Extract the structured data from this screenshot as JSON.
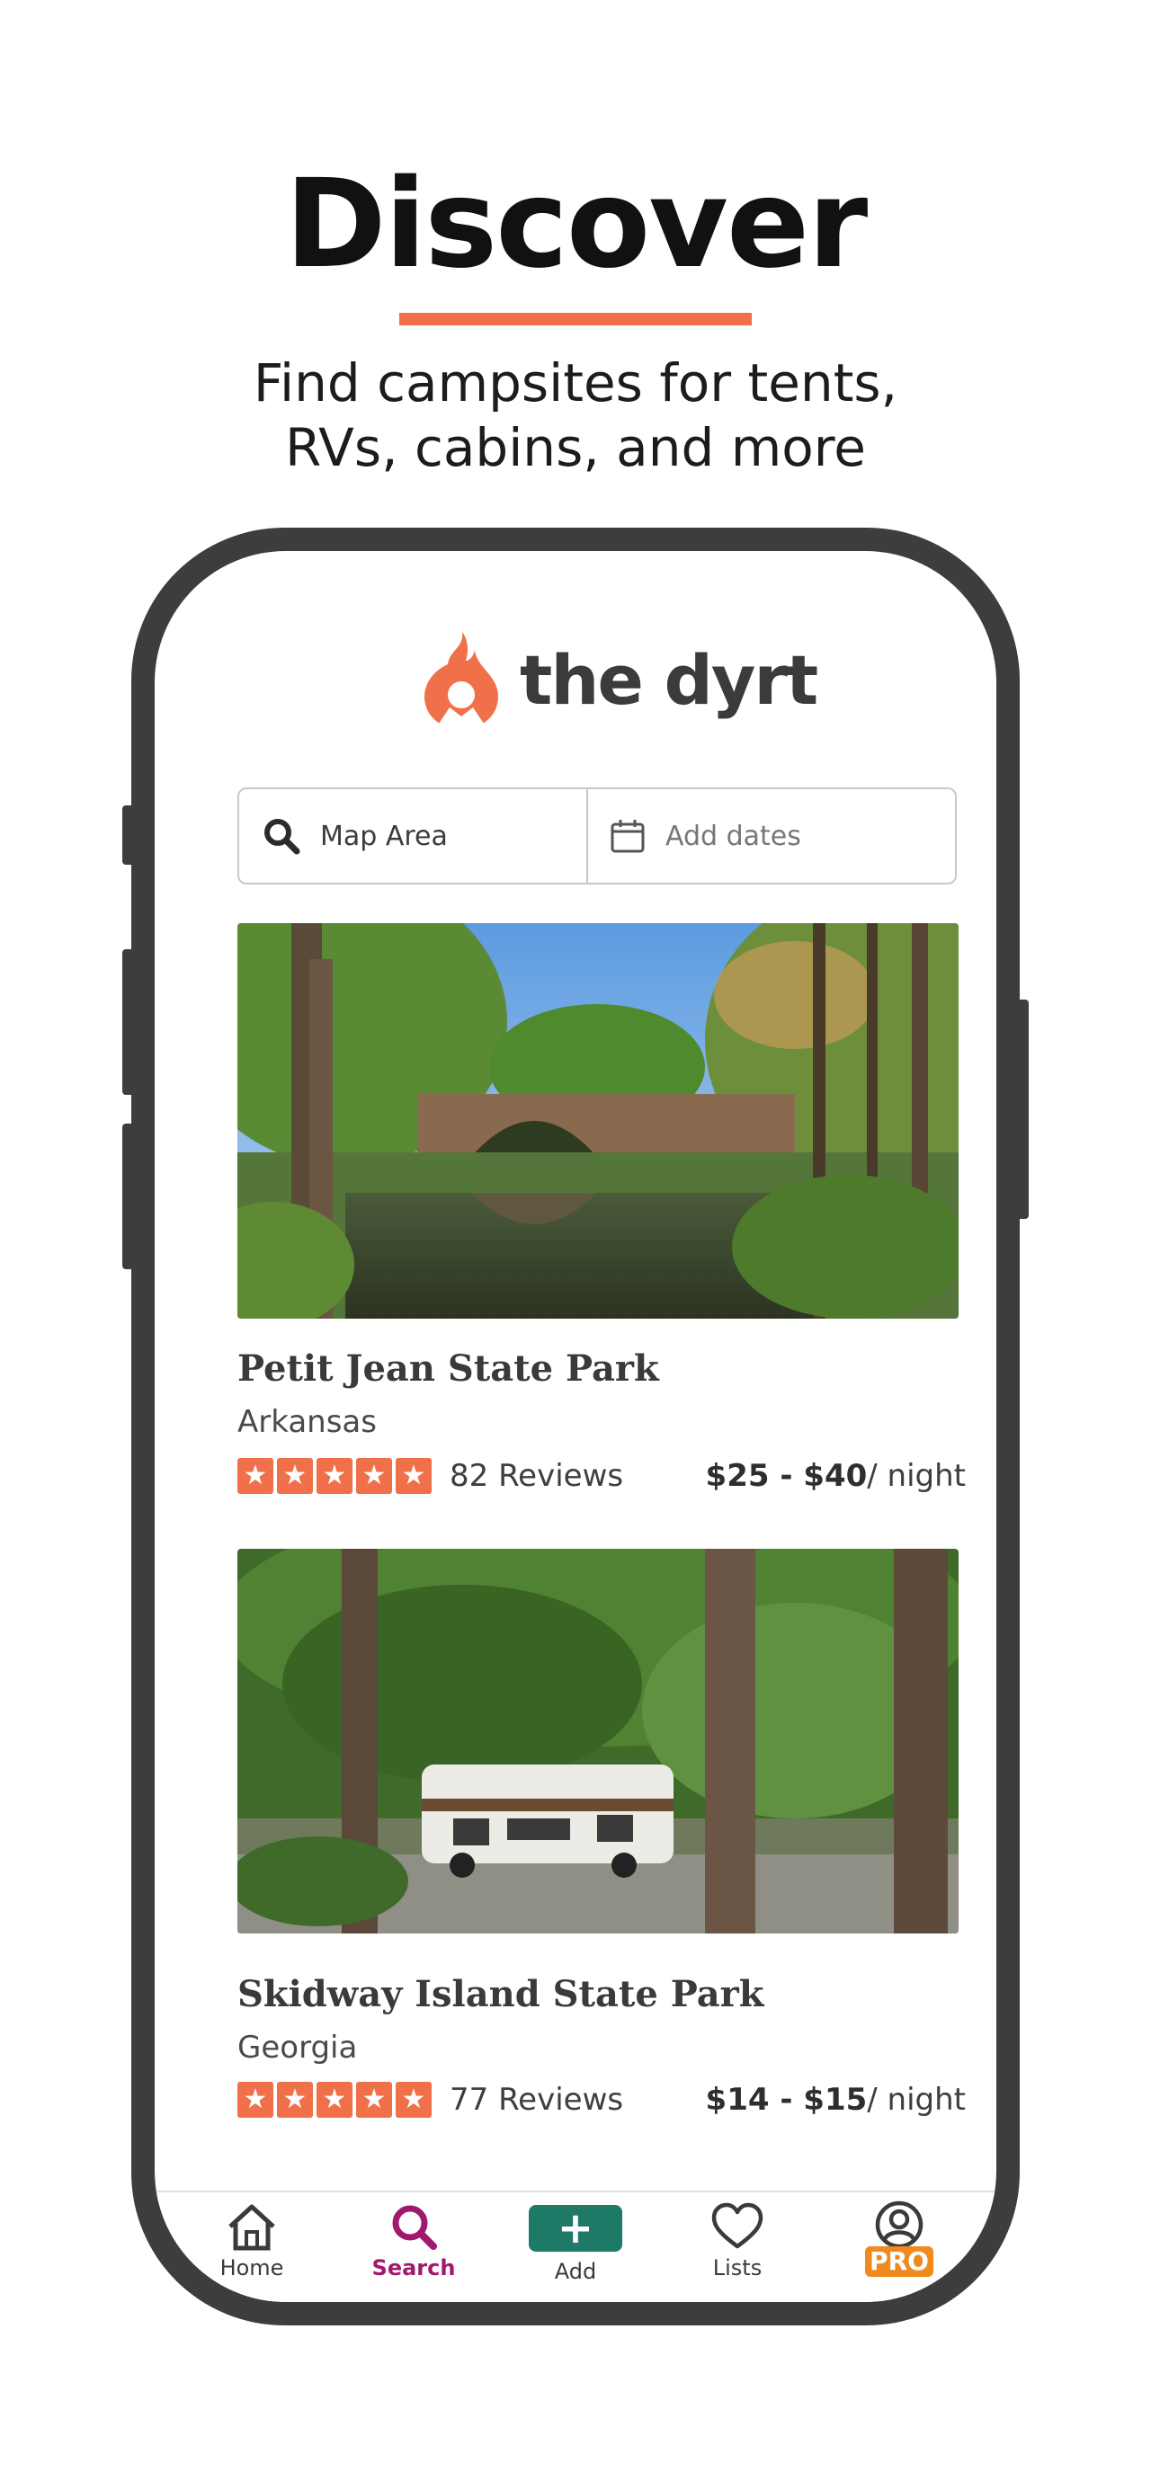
{
  "hero": {
    "title": "Discover",
    "subtitle_line1": "Find campsites for tents,",
    "subtitle_line2": "RVs, cabins, and more"
  },
  "app": {
    "brand": "the dyrt",
    "search": {
      "location_value": "Map Area",
      "dates_placeholder": "Add dates"
    },
    "listings": [
      {
        "name": "Petit Jean State Park",
        "state": "Arkansas",
        "rating": 5,
        "reviews": "82 Reviews",
        "price": "$25 - $40",
        "price_unit": "/ night"
      },
      {
        "name": "Skidway Island State Park",
        "state": "Georgia",
        "rating": 5,
        "reviews": "77 Reviews",
        "price": "$14 - $15",
        "price_unit": "/ night"
      }
    ],
    "tabbar": {
      "home": "Home",
      "search": "Search",
      "add": "Add",
      "lists": "Lists",
      "pro": "PRO",
      "active": "search"
    }
  },
  "colors": {
    "accent": "#f0704a",
    "active_tab": "#a0196e",
    "add_button": "#1e7a66",
    "pro_badge": "#f08a1e",
    "phone_frame": "#3d3d3f"
  }
}
